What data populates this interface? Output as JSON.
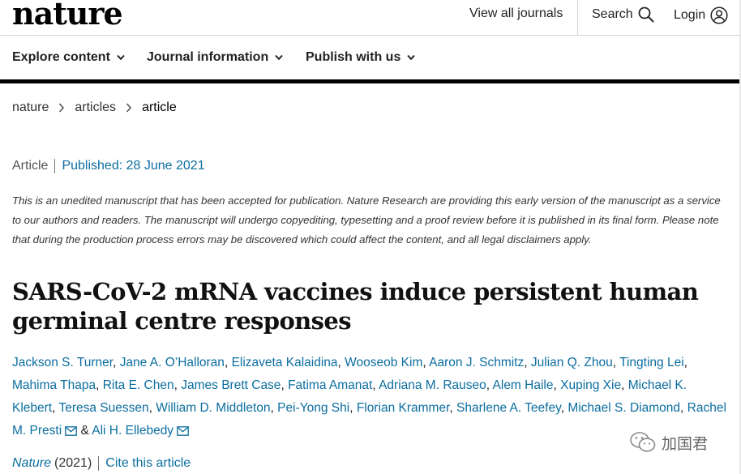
{
  "header": {
    "logo": "nature",
    "view_all_journals": "View all journals",
    "search_label": "Search",
    "login_label": "Login"
  },
  "nav": {
    "items": [
      {
        "label": "Explore content"
      },
      {
        "label": "Journal information"
      },
      {
        "label": "Publish with us"
      }
    ]
  },
  "breadcrumb": {
    "items": [
      "nature",
      "articles",
      "article"
    ]
  },
  "article": {
    "type": "Article",
    "published": "Published: 28 June 2021",
    "notice": "This is an unedited manuscript that has been accepted for publication. Nature Research are providing this early version of the manuscript as a service to our authors and readers. The manuscript will undergo copyediting, typesetting and a proof review before it is published in its final form. Please note that during the production process errors may be discovered which could affect the content, and all legal disclaimers apply.",
    "title": "SARS-CoV-2 mRNA vaccines induce persistent human germinal centre responses",
    "authors": [
      "Jackson S. Turner",
      "Jane A. O’Halloran",
      "Elizaveta Kalaidina",
      "Wooseob Kim",
      "Aaron J. Schmitz",
      "Julian Q. Zhou",
      "Tingting Lei",
      "Mahima Thapa",
      "Rita E. Chen",
      "James Brett Case",
      "Fatima Amanat",
      "Adriana M. Rauseo",
      "Alem Haile",
      "Xuping Xie",
      "Michael K. Klebert",
      "Teresa Suessen",
      "William D. Middleton",
      "Pei-Yong Shi",
      "Florian Krammer",
      "Sharlene A. Teefey",
      "Michael S. Diamond",
      "Rachel M. Presti",
      "Ali H. Ellebedy"
    ],
    "author_separator": ", ",
    "author_amp": " & ",
    "journal_name": "Nature",
    "journal_year": "(2021)",
    "cite_label": "Cite this article"
  },
  "watermark": {
    "text": "加国君"
  },
  "colors": {
    "link": "#0c6ea0",
    "text": "#222222",
    "rule": "#000000"
  }
}
